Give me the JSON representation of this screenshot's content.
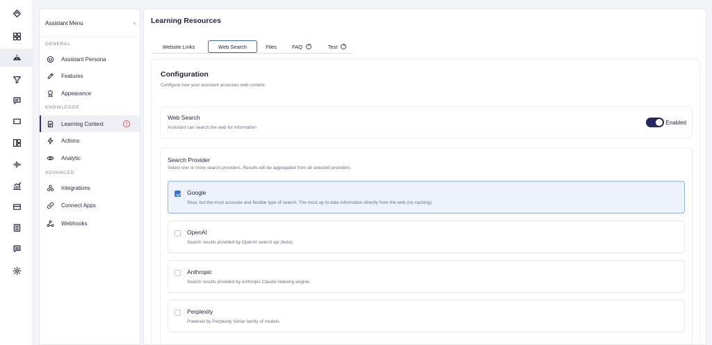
{
  "rail": {
    "items": [
      {
        "icon": "logo-diamond-icon"
      },
      {
        "icon": "dashboard-grid-icon"
      },
      {
        "icon": "assistant-icon",
        "active": true
      },
      {
        "icon": "filter-icon"
      },
      {
        "icon": "chat-icon"
      },
      {
        "icon": "ticket-icon"
      },
      {
        "icon": "layout-icon"
      },
      {
        "icon": "audio-waveform-icon"
      },
      {
        "icon": "analytics-icon"
      },
      {
        "icon": "credit-card-icon"
      },
      {
        "icon": "document-list-icon"
      },
      {
        "icon": "message-icon"
      },
      {
        "icon": "settings-gear-icon"
      }
    ]
  },
  "menu": {
    "title": "Assistant Menu",
    "collapse_glyph": "‹",
    "sections": {
      "general": "GENERAL",
      "knowledge": "KNOWLEDGE",
      "advanced": "ADVANCED"
    },
    "items": {
      "assistant_persona": "Assistant Persona",
      "features": "Features",
      "appearance": "Appearance",
      "learning_context": "Learning Context",
      "actions": "Actions",
      "analytic": "Analytic",
      "integrations": "Integrations",
      "connect_apps": "Connect Apps",
      "webhooks": "Webhooks"
    },
    "alert_glyph": "!"
  },
  "main": {
    "title": "Learning Resources",
    "tabs": {
      "website_links": "Website  Links",
      "web_search": "Web  Search",
      "files": "Files",
      "faq": "FAQ",
      "test": "Test",
      "help_glyph": "?"
    },
    "active_tab": "web_search",
    "configuration": {
      "title": "Configuration",
      "subtitle": "Configure how your assistant accesses web content"
    },
    "web_search": {
      "title": "Web Search",
      "subtitle": "Assistant can search the web for information",
      "toggle_label": "Enabled",
      "enabled": true
    },
    "search_provider": {
      "title": "Search Provider",
      "subtitle": "Select one or more search providers. Results will be aggregated from all selected providers.",
      "providers": [
        {
          "name": "Google",
          "desc": "Slow, but the most accurate and flexible type of search. The most up to date information directly from the web (no caching).",
          "checked": true
        },
        {
          "name": "OpenAI",
          "desc": "Search results provided by OpenAI search api (beta).",
          "checked": false
        },
        {
          "name": "Anthropic",
          "desc": "Search results provided by Anthropic Claude indexing engine.",
          "checked": false
        },
        {
          "name": "Perplexity",
          "desc": "Powered by Perplexity Sonar family of models.",
          "checked": false
        }
      ]
    }
  },
  "colors": {
    "accent": "#25285e",
    "checkbox": "#3a72cf",
    "selected_bg": "#eef3fb",
    "alert": "#e5534b"
  }
}
